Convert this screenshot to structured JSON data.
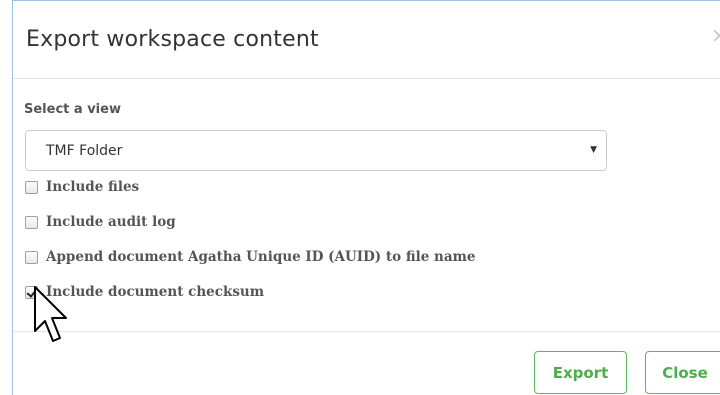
{
  "dialog": {
    "title": "Export workspace content",
    "close_glyph": "×"
  },
  "view": {
    "label": "Select a view",
    "selected": "TMF Folder",
    "caret": "▼"
  },
  "options": [
    {
      "label": "Include files",
      "checked": false
    },
    {
      "label": "Include audit log",
      "checked": false
    },
    {
      "label": "Append document Agatha Unique ID (AUID) to file name",
      "checked": false
    },
    {
      "label": "Include document checksum",
      "checked": true
    }
  ],
  "footer": {
    "export_label": "Export",
    "close_label": "Close"
  },
  "colors": {
    "accent_green": "#5cb85c",
    "dialog_border": "#9ec0e0"
  },
  "icons": [
    "close-icon",
    "caret-down-icon",
    "mouse-pointer-icon"
  ]
}
